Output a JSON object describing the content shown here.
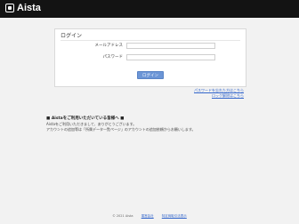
{
  "header": {
    "logo_text": "Aista"
  },
  "login": {
    "title": "ログイン",
    "email_label": "メールアドレス",
    "email_value": "",
    "password_label": "パスワード",
    "password_value": "",
    "submit_label": "ログイン"
  },
  "links": {
    "forgot_password": "パスワードを忘れた方はこちら",
    "unlock_account": "ロック解除はこちら"
  },
  "notice": {
    "heading": "■ Aistaをご利用いただいている皆様へ ■",
    "line1": "Aistaをご利用いただきまして、ありがとうございます。",
    "line2": "アカウントの追加等は「所属データ一覧ページ」のアカウントの追加依頼からお願いします。"
  },
  "footer": {
    "copyright": "© 2021 Aista",
    "link1": "運営会社",
    "link2": "特定商取引法表示"
  }
}
